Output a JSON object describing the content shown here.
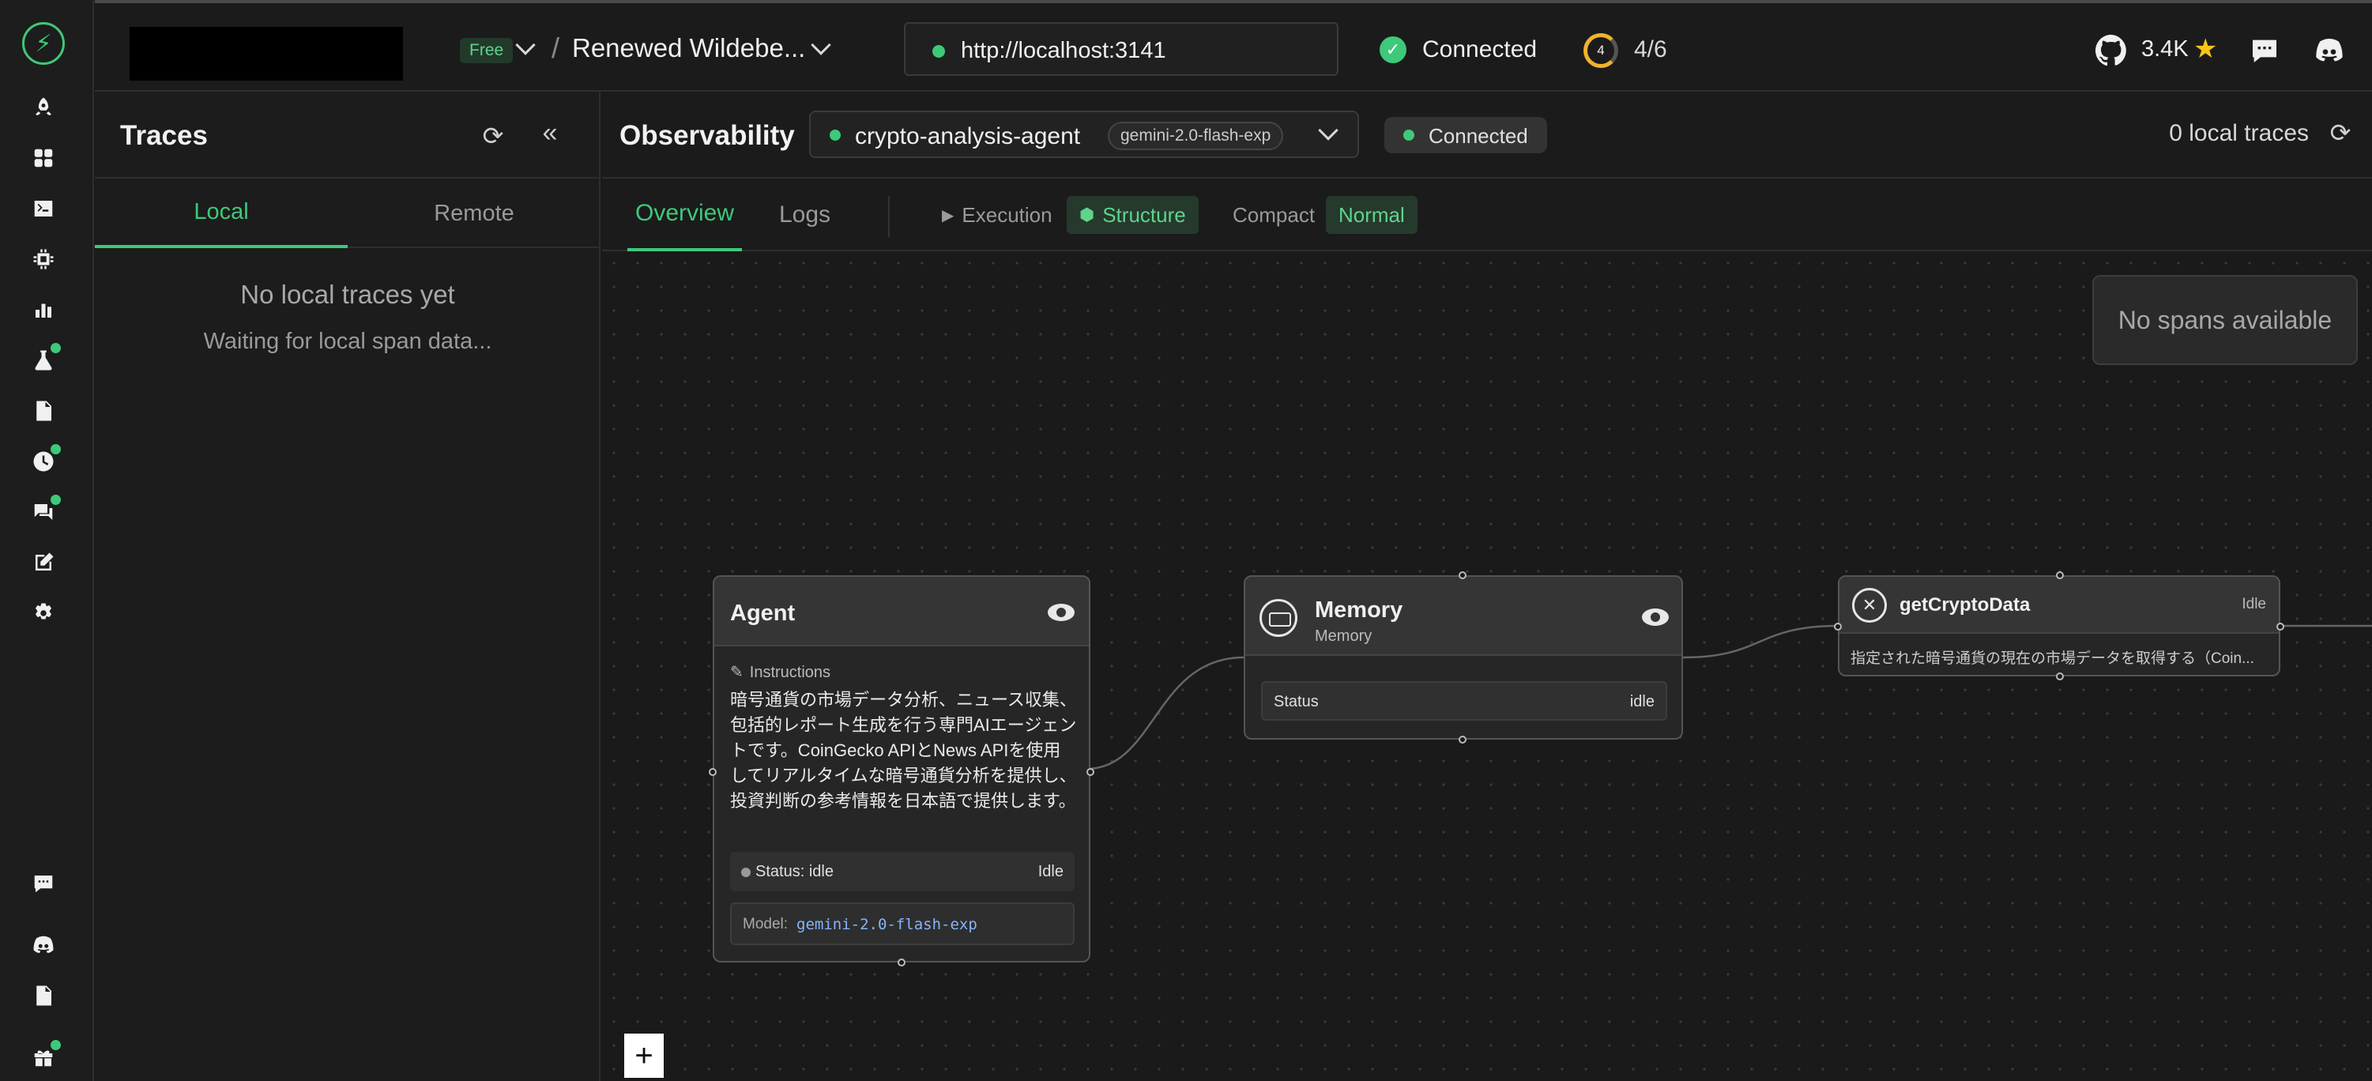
{
  "topbar": {
    "plan": "Free",
    "project_name": "Renewed Wildebe...",
    "url": "http://localhost:3141",
    "connection": "Connected",
    "progress_ring_value": "4",
    "progress_text": "4/6",
    "github_stars": "3.4K"
  },
  "rail": {
    "icons": [
      "bolt-logo",
      "rocket",
      "grid",
      "terminal",
      "chip",
      "bar-chart",
      "flask",
      "document",
      "clock",
      "chat",
      "edit",
      "gear",
      "chat-bubble",
      "discord",
      "file",
      "gift"
    ]
  },
  "traces": {
    "title": "Traces",
    "tabs": [
      "Local",
      "Remote"
    ],
    "active_tab": "Local",
    "empty_title": "No local traces yet",
    "empty_subtitle": "Waiting for local span data..."
  },
  "observability": {
    "title": "Observability",
    "agent_name": "crypto-analysis-agent",
    "model": "gemini-2.0-flash-exp",
    "status": "Connected",
    "local_trace_count": "0 local traces"
  },
  "view_tabs": {
    "tabs": [
      "Overview",
      "Logs"
    ],
    "active_tab": "Overview",
    "mode_execution": "Execution",
    "mode_structure": "Structure",
    "density_compact": "Compact",
    "density_normal": "Normal"
  },
  "canvas": {
    "no_spans": "No spans available",
    "agent_node": {
      "title": "Agent",
      "instructions_label": "Instructions",
      "instructions": "暗号通貨の市場データ分析、ニュース収集、包括的レポート生成を行う専門AIエージェントです。CoinGecko APIとNews APIを使用してリアルタイムな暗号通貨分析を提供し、投資判断の参考情報を日本語で提供します。",
      "status_label": "Status: idle",
      "status_badge": "Idle",
      "model_label": "Model:",
      "model_value": "gemini-2.0-flash-exp"
    },
    "memory_node": {
      "title": "Memory",
      "subtitle": "Memory",
      "status_label": "Status",
      "status_value": "idle"
    },
    "tool_node": {
      "title": "getCryptoData",
      "state": "Idle",
      "description": "指定された暗号通貨の現在の市場データを取得する（Coin..."
    },
    "plus_label": "+"
  },
  "colors": {
    "accent": "#3ec97a",
    "background": "#1a1a1a",
    "star": "#f5c518",
    "model_text": "#86b4ff"
  }
}
